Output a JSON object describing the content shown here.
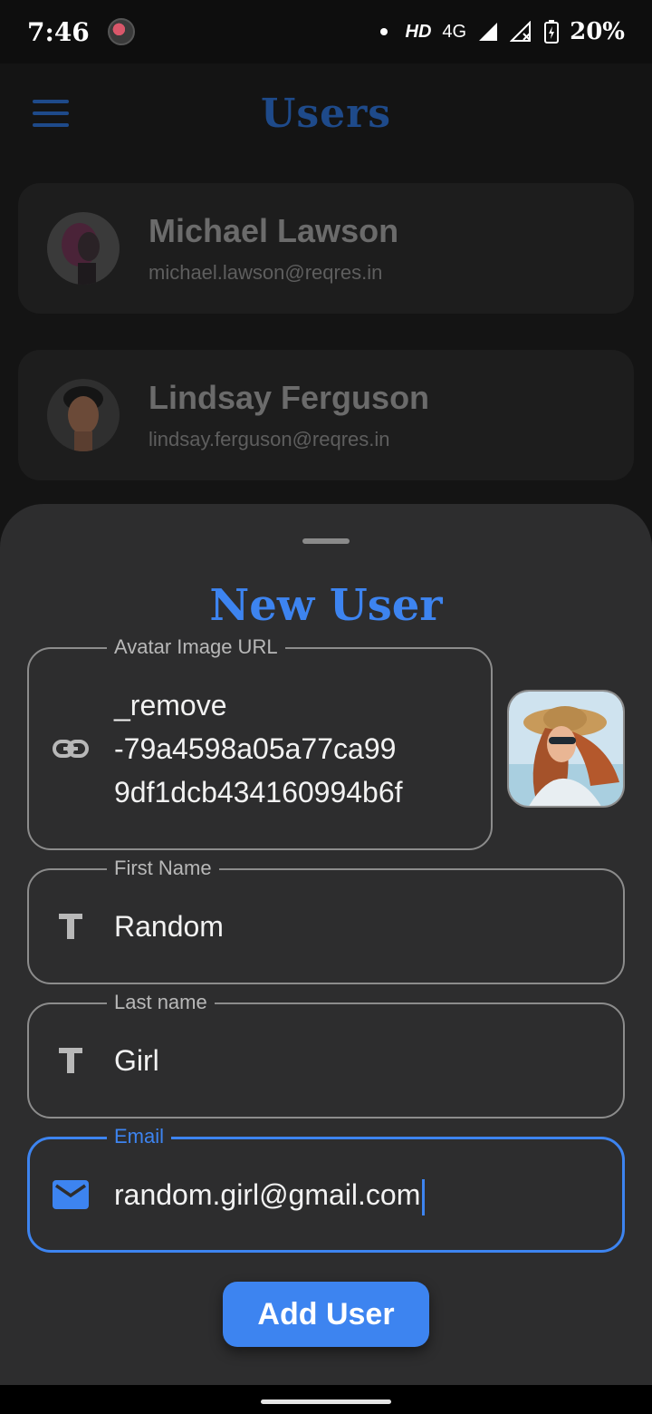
{
  "status_bar": {
    "time": "7:46",
    "network_hd": "HD",
    "network_type": "4G",
    "battery": "20%"
  },
  "appbar": {
    "title": "Users"
  },
  "users": [
    {
      "name": "Michael Lawson",
      "email": "michael.lawson@reqres.in"
    },
    {
      "name": "Lindsay Ferguson",
      "email": "lindsay.ferguson@reqres.in"
    }
  ],
  "sheet": {
    "title": "New User",
    "avatar_field": {
      "label": "Avatar Image URL",
      "value_lines": [
        "_remove",
        "-79a4598a05a77ca99",
        "9df1dcb434160994b6f"
      ]
    },
    "first_name_field": {
      "label": "First Name",
      "value": "Random"
    },
    "last_name_field": {
      "label": "Last name",
      "value": "Girl"
    },
    "email_field": {
      "label": "Email",
      "value": "random.girl@gmail.com"
    },
    "submit_label": "Add User"
  },
  "colors": {
    "accent": "#3d84f0",
    "appbar_accent": "#1e4a8a",
    "sheet_bg": "#2d2d2e"
  },
  "icons": {
    "avatar_field": "link-icon",
    "first_name_field": "text-t-icon",
    "last_name_field": "text-t-icon",
    "email_field": "mail-icon"
  }
}
